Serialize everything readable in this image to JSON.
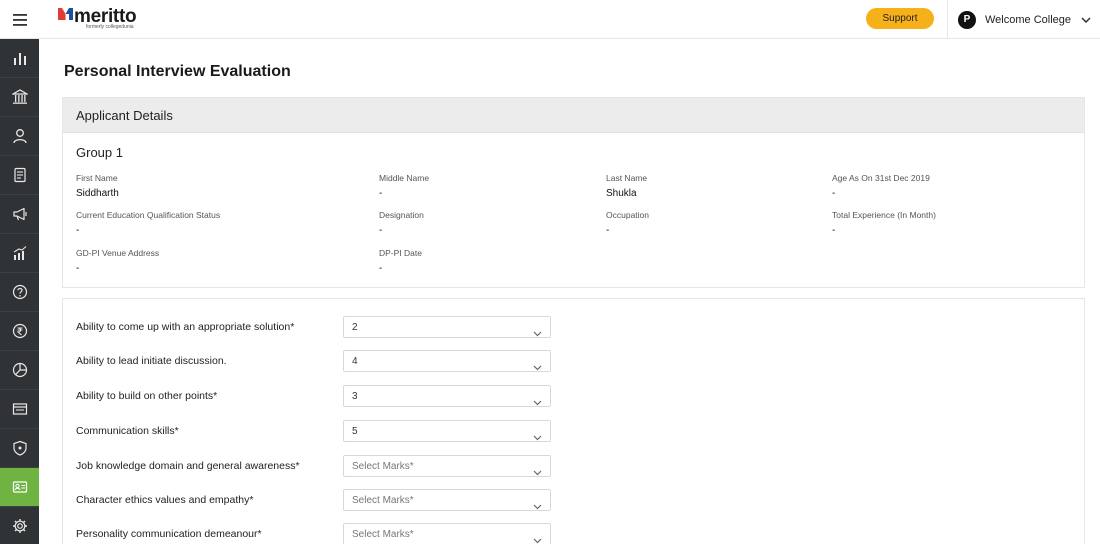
{
  "header": {
    "logo_text": "meritto",
    "logo_tagline": "formerly collegedunia",
    "support_label": "Support",
    "avatar_letter": "P",
    "user_name": "Welcome College"
  },
  "sidebar": {
    "items": [
      {
        "icon": "bar-chart-icon",
        "active": false
      },
      {
        "icon": "institution-icon",
        "active": false
      },
      {
        "icon": "user-icon",
        "active": false
      },
      {
        "icon": "document-icon",
        "active": false
      },
      {
        "icon": "megaphone-icon",
        "active": false
      },
      {
        "icon": "growth-chart-icon",
        "active": false
      },
      {
        "icon": "help-icon",
        "active": false
      },
      {
        "icon": "rupee-icon",
        "active": false
      },
      {
        "icon": "pie-chart-icon",
        "active": false
      },
      {
        "icon": "browser-window-icon",
        "active": false
      },
      {
        "icon": "shield-icon",
        "active": false
      },
      {
        "icon": "id-card-icon",
        "active": true
      },
      {
        "icon": "gear-icon",
        "active": false
      }
    ],
    "active_color": "#6fb443"
  },
  "page": {
    "title": "Personal Interview Evaluation"
  },
  "applicant": {
    "section_title": "Applicant Details",
    "group_title": "Group 1",
    "fields": [
      {
        "label": "First Name",
        "value": "Siddharth"
      },
      {
        "label": "Middle Name",
        "value": "-"
      },
      {
        "label": "Last Name",
        "value": "Shukla"
      },
      {
        "label": "Age As On 31st Dec 2019",
        "value": "-"
      },
      {
        "label": "Current Education Qualification Status",
        "value": "-"
      },
      {
        "label": "Designation",
        "value": "-"
      },
      {
        "label": "Occupation",
        "value": "-"
      },
      {
        "label": "Total Experience (In Month)",
        "value": "-"
      },
      {
        "label": "GD-PI Venue Address",
        "value": "-"
      },
      {
        "label": "DP-PI Date",
        "value": "-"
      }
    ]
  },
  "evaluation": {
    "criteria": [
      {
        "label": "Ability to come up with an appropriate solution*",
        "value": "2"
      },
      {
        "label": "Ability to lead initiate discussion.",
        "value": "4"
      },
      {
        "label": "Ability to build on other points*",
        "value": "3"
      },
      {
        "label": "Communication skills*",
        "value": "5"
      },
      {
        "label": "Job knowledge domain and general awareness*",
        "value": "Select Marks*"
      },
      {
        "label": "Character ethics values and empathy*",
        "value": "Select Marks*"
      },
      {
        "label": "Personality communication demeanour*",
        "value": "Select Marks*"
      }
    ]
  }
}
